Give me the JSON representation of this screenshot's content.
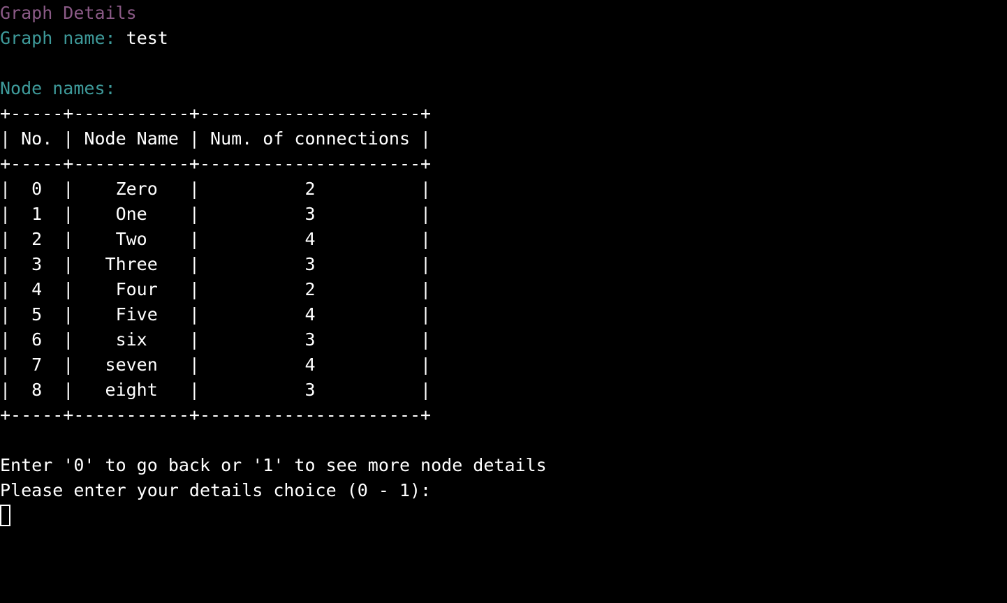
{
  "header": {
    "title": "Graph Details",
    "graph_name_label": "Graph name:",
    "graph_name_value": "test"
  },
  "nodes_section": {
    "label": "Node names:"
  },
  "table": {
    "border_line": "+-----+-----------+---------------------+",
    "header_line": "| No. | Node Name | Num. of connections |",
    "rows": [
      "|  0  |    Zero   |          2          |",
      "|  1  |    One    |          3          |",
      "|  2  |    Two    |          4          |",
      "|  3  |   Three   |          3          |",
      "|  4  |    Four   |          2          |",
      "|  5  |    Five   |          4          |",
      "|  6  |    six    |          3          |",
      "|  7  |   seven   |          4          |",
      "|  8  |   eight   |          3          |"
    ]
  },
  "prompt": {
    "instruction": "Enter '0' to go back or '1' to see more node details",
    "question": "Please enter your details choice (0 - 1):",
    "input_value": ""
  },
  "colors": {
    "title": "#8a5a86",
    "label": "#3e9a9a",
    "text": "#ffffff",
    "background": "#000000"
  }
}
